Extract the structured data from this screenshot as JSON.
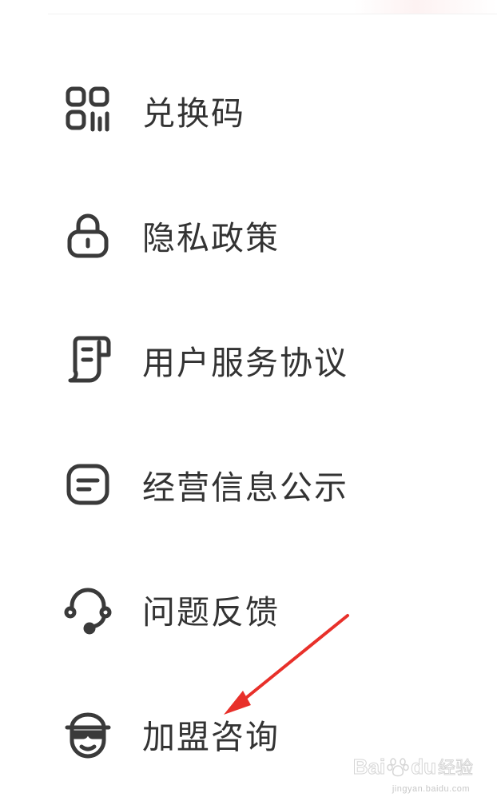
{
  "menu": {
    "items": [
      {
        "label": "兑换码",
        "icon": "qr-code-icon"
      },
      {
        "label": "隐私政策",
        "icon": "lock-icon"
      },
      {
        "label": "用户服务协议",
        "icon": "document-scroll-icon"
      },
      {
        "label": "经营信息公示",
        "icon": "notice-box-icon"
      },
      {
        "label": "问题反馈",
        "icon": "headset-icon"
      },
      {
        "label": "加盟咨询",
        "icon": "person-glasses-icon"
      }
    ]
  },
  "annotation": {
    "arrow_color": "#e8302a"
  },
  "watermark": {
    "brand_left": "Bai",
    "brand_right": "du",
    "brand_cn": "经验",
    "domain": "jingyan.baidu.com"
  },
  "colors": {
    "text": "#333333",
    "icon_stroke": "#3a3a3a",
    "arrow": "#e8302a"
  }
}
